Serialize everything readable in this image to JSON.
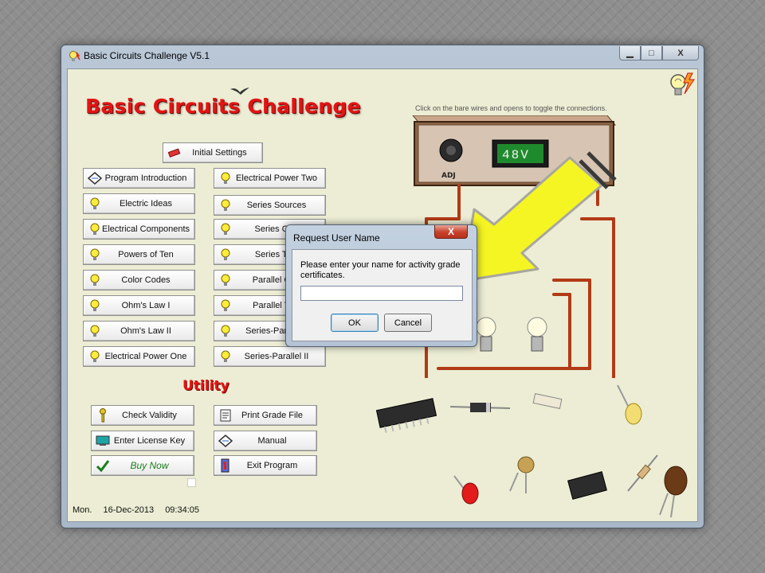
{
  "window": {
    "title": "Basic Circuits Challenge V5.1",
    "minimize": "▁",
    "maximize": "□",
    "close": "X"
  },
  "app": {
    "heading": "Basic Circuits Challenge",
    "instruction": "Click on the bare wires and opens to toggle the connections."
  },
  "settings_button": "Initial Settings",
  "left_column": [
    "Program Introduction",
    "Electric Ideas",
    "Electrical Components",
    "Powers of Ten",
    "Color Codes",
    "Ohm's Law I",
    "Ohm's Law II",
    "Electrical Power One"
  ],
  "right_column": [
    "Electrical Power Two",
    "Series Sources",
    "Series One",
    "Series Two",
    "Parallel One",
    "Parallel Two",
    "Series-Parallel I",
    "Series-Parallel II"
  ],
  "utility": {
    "heading": "Utility",
    "check_validity": "Check Validity",
    "print_grade": "Print Grade File",
    "enter_license": "Enter License Key",
    "manual": "Manual",
    "buy_now": "Buy Now",
    "exit": "Exit Program"
  },
  "status": {
    "day": "Mon.",
    "date": "16-Dec-2013",
    "time": "09:34:05"
  },
  "power_supply": {
    "voltage": "48V",
    "knob_label": "ADJ"
  },
  "dialog": {
    "title": "Request User Name",
    "close": "X",
    "message": "Please enter your name for activity grade certificates.",
    "input_value": "",
    "ok": "OK",
    "cancel": "Cancel"
  },
  "colors": {
    "title_red": "#e41414",
    "client_bg": "#ecedd4",
    "wire": "#b23a16",
    "arrow": "#f5f523",
    "display_green": "#1f8a2d",
    "buy_now_green": "#1a7d1a"
  }
}
